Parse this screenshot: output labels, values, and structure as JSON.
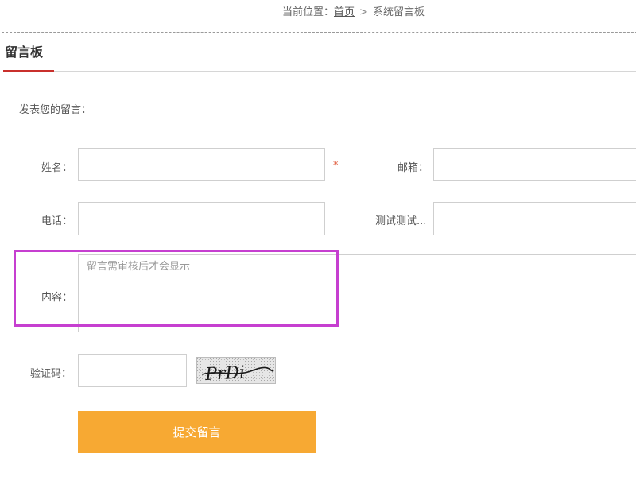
{
  "breadcrumb": {
    "prefix": "当前位置：",
    "home": "首页",
    "separator": ">",
    "current": "系统留言板"
  },
  "panel": {
    "title": "留言板",
    "accent_color": "#c9302c"
  },
  "form": {
    "intro": "发表您的留言：",
    "name_label": "姓名：",
    "name_value": "",
    "required_mark": "*",
    "email_label": "邮箱：",
    "email_value": "",
    "phone_label": "电话：",
    "phone_value": "",
    "test_label": "测试测试...",
    "test_value": "",
    "content_label": "内容：",
    "content_placeholder": "留言需审核后才会显示",
    "captcha_label": "验证码：",
    "captcha_value": "",
    "captcha_text": "PrDi",
    "submit_label": "提交留言",
    "submit_color": "#f7a933",
    "highlight_color": "#c63fd0"
  }
}
